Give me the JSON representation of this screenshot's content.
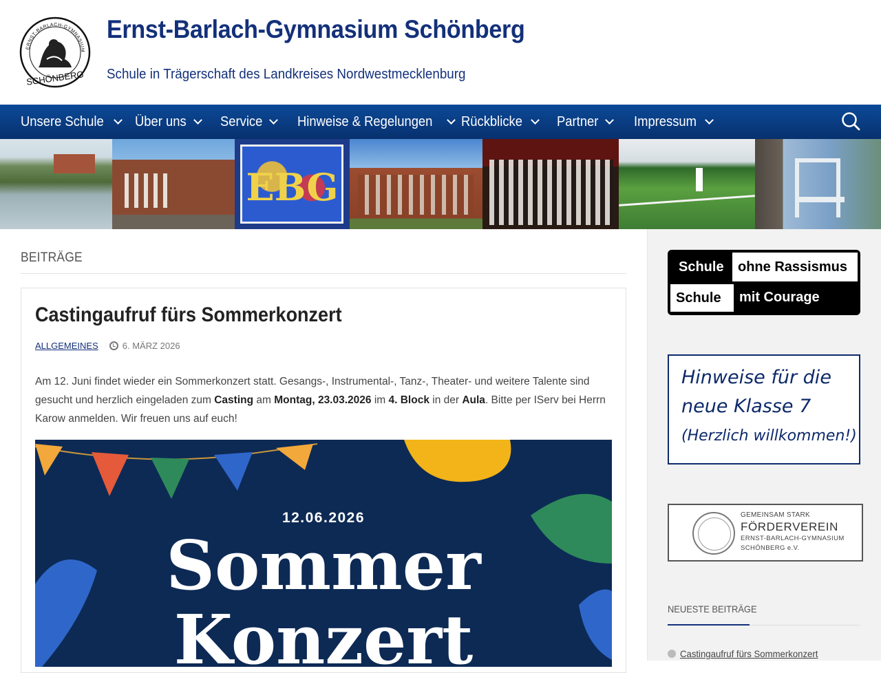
{
  "site": {
    "title": "Ernst-Barlach-Gymnasium Schönberg",
    "description": "Schule in Trägerschaft des Landkreises Nordwestmecklenburg",
    "logo_text": "ERNST-BARLACH-GYMNASIUM SCHÖNBERG"
  },
  "nav": {
    "items": [
      {
        "label": "Unsere Schule"
      },
      {
        "label": "Über uns"
      },
      {
        "label": "Service"
      },
      {
        "label": "Hinweise & Regelungen"
      },
      {
        "label": "Rückblicke"
      },
      {
        "label": "Partner"
      },
      {
        "label": "Impressum"
      }
    ],
    "search_icon": "search-icon",
    "chevron_icon": "chevron-down-icon",
    "bar_color": "#0b4a98"
  },
  "banner": {
    "graffiti_text": "EBG"
  },
  "archive": {
    "title": "Beiträge"
  },
  "post": {
    "title": "Castingaufruf fürs Sommerkonzert",
    "category": "Allgemeines",
    "date": "6. März 2026",
    "text_1": "Am 12. Juni findet wieder ein Sommerkonzert statt. Gesangs-, Instrumental-, Tanz-, Theater- und weitere Talente sind gesucht und herzlich eingeladen zum ",
    "bold_casting": "Casting",
    "text_2": " am ",
    "bold_date": "Montag, 23.03.2026",
    "text_3": " im ",
    "bold_block": "4. Block",
    "text_4": " in der ",
    "bold_aula": "Aula",
    "text_5": ". Bitte per IServ bei Herrn Karow anmelden. Wir freuen uns auf euch!",
    "poster": {
      "date": "12.06.2026",
      "line_1": "Sommer",
      "line_2": "Konzert"
    }
  },
  "sidebar": {
    "courage": {
      "schule_1": "Schule",
      "ohne": "ohne Rassismus",
      "schule_2": "Schule",
      "mit": "mit Courage"
    },
    "klasse7": {
      "line_1": "Hinweise für die",
      "line_2": "neue Klasse 7",
      "line_3": "(Herzlich willkommen!)"
    },
    "foerderverein": {
      "line_1": "GEMEINSAM STARK",
      "line_2": "FÖRDERVEREIN",
      "line_3": "ERNST-BARLACH-GYMNASIUM",
      "line_4": "SCHÖNBERG e.V."
    },
    "recent_title": "Neueste Beiträge",
    "recent_items": [
      {
        "label": "Castingaufruf fürs Sommerkonzert"
      }
    ]
  },
  "colors": {
    "brand": "#13307a",
    "poster_bg": "#0d2a55"
  }
}
